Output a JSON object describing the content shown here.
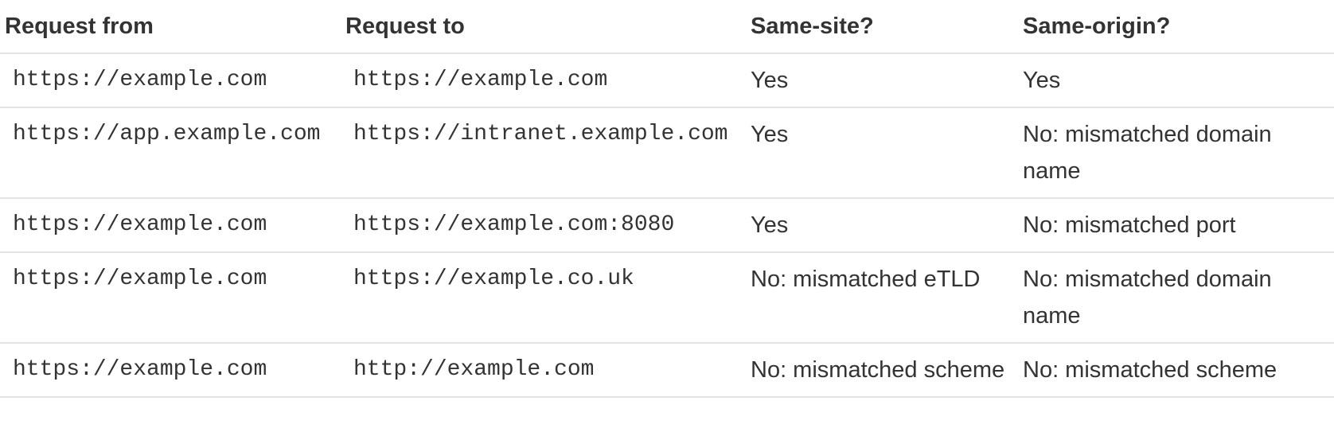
{
  "table": {
    "headers": [
      "Request from",
      "Request to",
      "Same-site?",
      "Same-origin?"
    ],
    "rows": [
      {
        "from": "https://example.com",
        "to": "https://example.com",
        "same_site": "Yes",
        "same_origin": "Yes"
      },
      {
        "from": "https://app.example.com",
        "to": "https://intranet.example.com",
        "same_site": "Yes",
        "same_origin": "No: mismatched domain name"
      },
      {
        "from": "https://example.com",
        "to": "https://example.com:8080",
        "same_site": "Yes",
        "same_origin": "No: mismatched port"
      },
      {
        "from": "https://example.com",
        "to": "https://example.co.uk",
        "same_site": "No: mismatched eTLD",
        "same_origin": "No: mismatched domain name"
      },
      {
        "from": "https://example.com",
        "to": "http://example.com",
        "same_site": "No: mismatched scheme",
        "same_origin": "No: mismatched scheme"
      }
    ]
  }
}
